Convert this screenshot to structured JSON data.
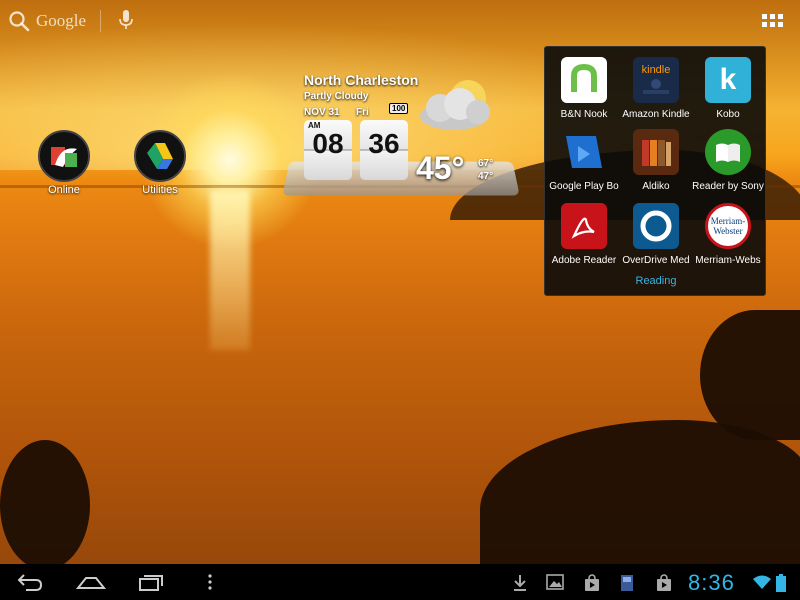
{
  "search": {
    "label": "Google"
  },
  "desktop": {
    "icons": [
      {
        "label": "Online"
      },
      {
        "label": "Utilities"
      }
    ]
  },
  "weather": {
    "city": "North Charleston",
    "condition": "Partly Cloudy",
    "date": "NOV  31",
    "day": "Fri",
    "battery": "100",
    "ampm": "AM",
    "hour": "08",
    "minute": "36",
    "temp": "45°",
    "high": "67°",
    "low": "47°"
  },
  "folder": {
    "name": "Reading",
    "apps": [
      {
        "label": "B&N Nook",
        "color": "#ffffff"
      },
      {
        "label": "Amazon Kindle",
        "color": "#1a2b4a"
      },
      {
        "label": "Kobo",
        "color": "#2fb1d8"
      },
      {
        "label": "Google Play Bo",
        "color": "#1e6fd0"
      },
      {
        "label": "Aldiko",
        "color": "#5a2a10"
      },
      {
        "label": "Reader by Sony",
        "color": "#2a9b2a"
      },
      {
        "label": "Adobe Reader",
        "color": "#c8131a"
      },
      {
        "label": "OverDrive Med",
        "color": "#0c5a8f"
      },
      {
        "label": "Merriam-Webs",
        "color": "#ffffff"
      }
    ],
    "kindle_text": "kindle",
    "kobo_text": "k",
    "mw_text": "Merriam-Webster"
  },
  "statusbar": {
    "time": "8:36"
  },
  "colors": {
    "accent": "#33b5e5"
  }
}
